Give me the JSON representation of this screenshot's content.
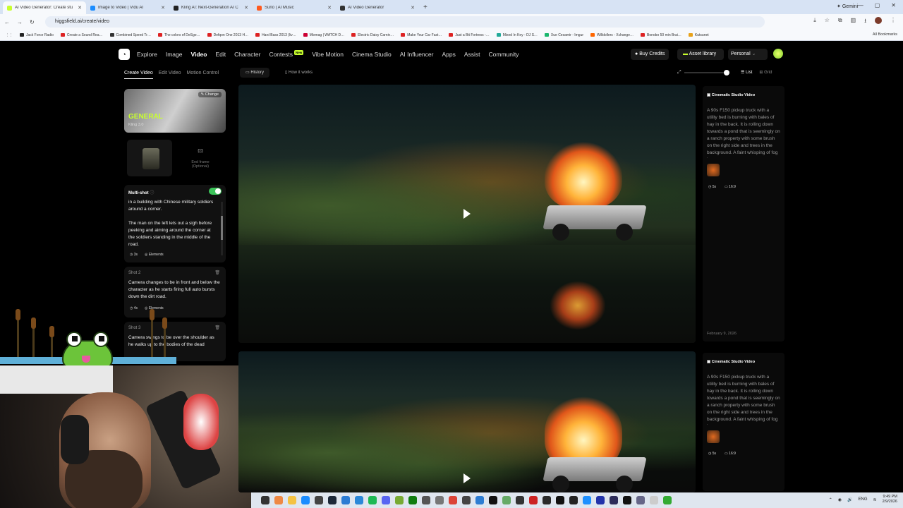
{
  "browser": {
    "tabs": [
      {
        "title": "AI Video Generator: Create stu",
        "color": "#c8ff2e",
        "active": true
      },
      {
        "title": "Image to Video | Vidu AI",
        "color": "#1a8cff",
        "active": false
      },
      {
        "title": "Kling AI: Next-Generation AI C",
        "color": "#222222",
        "active": false
      },
      {
        "title": "Suno | AI Music",
        "color": "#ff5a1f",
        "active": false
      },
      {
        "title": "AI Video Generator",
        "color": "#333333",
        "active": false
      }
    ],
    "new_tab": "+",
    "gemini": "✦ Gemini",
    "url": "higgsfield.ai/create/video",
    "bookmarks": [
      "Jack Force Radio",
      "Create a Sound Rea…",
      "Combined Speed Tr…",
      "The colors of DeSgo…",
      "Defqon One 2013 H…",
      "Hard Bass 2013 (liv…",
      "Mixmag | WATCH D…",
      "Electric Daisy Carniv…",
      "Make Your Car Fast…",
      "Just a Bit Fortress -…",
      "Mixed In Key - DJ S…",
      "Xue Cesamir - Imgur",
      "Willdollers - Xchange…",
      "Bonobo 50 min Brai…",
      "Kutsunet"
    ],
    "all_bookmarks": "All Bookmarks"
  },
  "app": {
    "nav": [
      "Explore",
      "Image",
      "Video",
      "Edit",
      "Character",
      "Contests",
      "Vibe Motion",
      "Cinema Studio",
      "AI Influencer",
      "Apps",
      "Assist",
      "Community"
    ],
    "active_nav": "Video",
    "new_badge": "New",
    "buy_credits": "Buy Credits",
    "asset_library": "Asset library",
    "workspace": "Personal"
  },
  "left": {
    "subtabs": [
      "Create Video",
      "Edit Video",
      "Motion Control"
    ],
    "model_title": "GENERAL",
    "model_name": "Kling 3.0",
    "change": "Change",
    "end_frame": "End frame",
    "optional": "(Optional)",
    "multishot": "Multi-shot",
    "shot1_text": "in a building with Chinese military soldiers around a corner.\n\nThe man on the left lets out a sigh before peeking and aiming around the corner at the soldiers standing in the middle of the road.",
    "shot1_duration": "3s",
    "elements": "Elements",
    "shot2_label": "Shot 2",
    "shot2_text": "Camera changes to be in front and below the character as he starts firing full auto bursts down the dirt road.",
    "shot2_duration": "4s",
    "shot3_label": "Shot 3",
    "shot3_text": "Camera swings to be over the shoulder as he walks up to the bodies of the dead"
  },
  "center": {
    "history": "History",
    "how": "How it works",
    "list": "List",
    "grid": "Grid"
  },
  "items": [
    {
      "badge": "Cinematic Studio Video",
      "prompt": "A 90s F150 pickup truck with a utility bed is burning with bales of hay in the back. It is rolling down towards a pond that is seemingly on a ranch property with some brush on the right side and trees in the background. A faint whisping of fog is over",
      "duration": "5s",
      "ratio": "16:9",
      "date": "February 9, 2026"
    },
    {
      "badge": "Cinematic Studio Video",
      "prompt": "A 90s F150 pickup truck with a utility bed is burning with bales of hay in the back. It is rolling down towards a pond that is seemingly on a ranch property with some brush on the right side and trees in the background. A faint whisping of fog is over",
      "duration": "5s",
      "ratio": "16:9",
      "date": ""
    }
  ],
  "system": {
    "time": "9:49 PM",
    "date": "2/9/2026",
    "lang": "ENG"
  },
  "colors": {
    "accent": "#c8ff2e",
    "toggle": "#3cc45a",
    "panel": "#111111"
  }
}
